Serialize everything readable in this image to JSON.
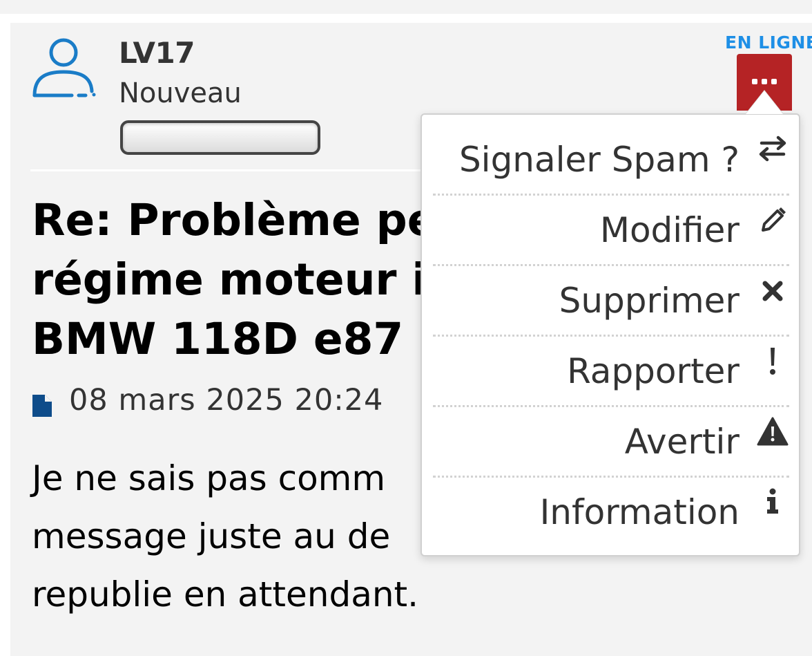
{
  "author": {
    "name": "LV17",
    "rank": "Nouveau",
    "status": "EN LIGNE"
  },
  "post": {
    "title_lines": [
      "Re: Problème per",
      "régime moteur ir",
      "BMW 118D e87"
    ],
    "date": "08 mars 2025 20:24",
    "body_lines": [
      "Je ne sais pas comm",
      "message juste au de",
      "republie en attendant."
    ]
  },
  "menu": {
    "items": [
      {
        "label": "Signaler Spam ?",
        "icon": "swap-arrows-icon"
      },
      {
        "label": "Modifier",
        "icon": "pencil-icon"
      },
      {
        "label": "Supprimer",
        "icon": "close-icon"
      },
      {
        "label": "Rapporter",
        "icon": "exclamation-icon"
      },
      {
        "label": "Avertir",
        "icon": "warning-icon"
      },
      {
        "label": "Information",
        "icon": "info-icon"
      }
    ]
  },
  "colors": {
    "accent_blue": "#1e8fe6",
    "avatar_blue": "#1a7cc7",
    "menu_button_red": "#b52325",
    "card_background": "#f3f3f3"
  }
}
